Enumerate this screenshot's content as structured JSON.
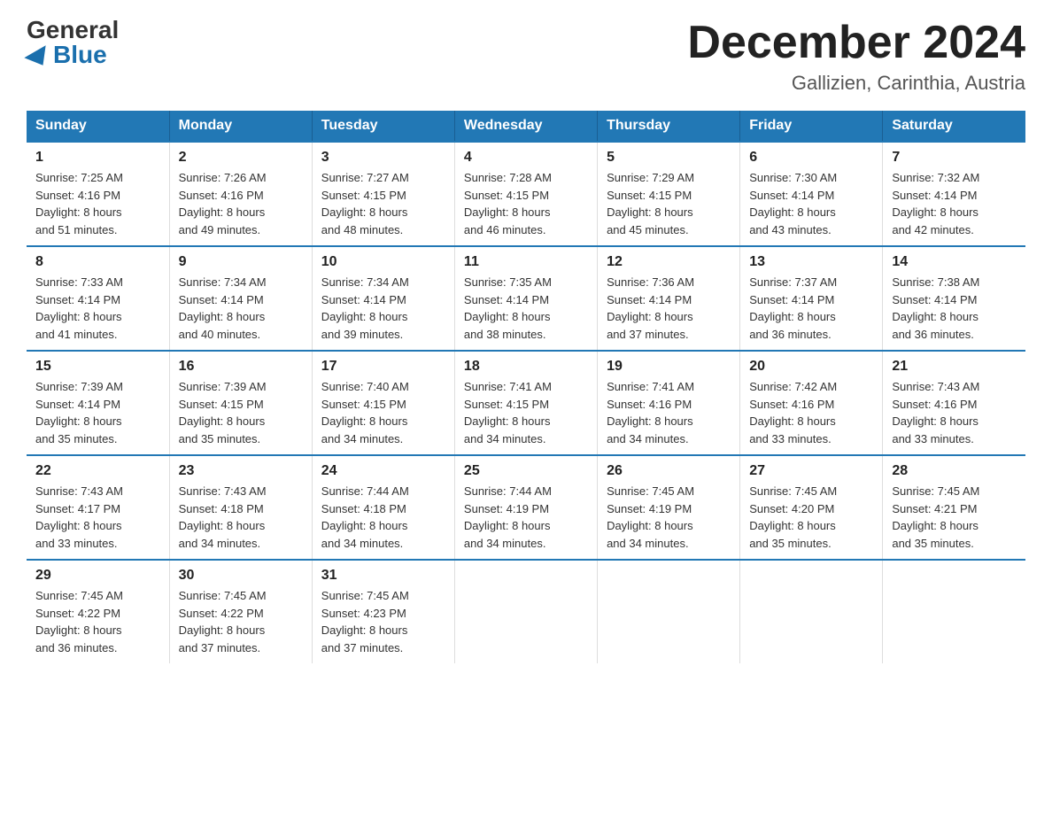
{
  "logo": {
    "general": "General",
    "blue": "Blue"
  },
  "title": "December 2024",
  "location": "Gallizien, Carinthia, Austria",
  "days_of_week": [
    "Sunday",
    "Monday",
    "Tuesday",
    "Wednesday",
    "Thursday",
    "Friday",
    "Saturday"
  ],
  "weeks": [
    [
      {
        "day": "1",
        "sunrise": "7:25 AM",
        "sunset": "4:16 PM",
        "daylight": "8 hours and 51 minutes."
      },
      {
        "day": "2",
        "sunrise": "7:26 AM",
        "sunset": "4:16 PM",
        "daylight": "8 hours and 49 minutes."
      },
      {
        "day": "3",
        "sunrise": "7:27 AM",
        "sunset": "4:15 PM",
        "daylight": "8 hours and 48 minutes."
      },
      {
        "day": "4",
        "sunrise": "7:28 AM",
        "sunset": "4:15 PM",
        "daylight": "8 hours and 46 minutes."
      },
      {
        "day": "5",
        "sunrise": "7:29 AM",
        "sunset": "4:15 PM",
        "daylight": "8 hours and 45 minutes."
      },
      {
        "day": "6",
        "sunrise": "7:30 AM",
        "sunset": "4:14 PM",
        "daylight": "8 hours and 43 minutes."
      },
      {
        "day": "7",
        "sunrise": "7:32 AM",
        "sunset": "4:14 PM",
        "daylight": "8 hours and 42 minutes."
      }
    ],
    [
      {
        "day": "8",
        "sunrise": "7:33 AM",
        "sunset": "4:14 PM",
        "daylight": "8 hours and 41 minutes."
      },
      {
        "day": "9",
        "sunrise": "7:34 AM",
        "sunset": "4:14 PM",
        "daylight": "8 hours and 40 minutes."
      },
      {
        "day": "10",
        "sunrise": "7:34 AM",
        "sunset": "4:14 PM",
        "daylight": "8 hours and 39 minutes."
      },
      {
        "day": "11",
        "sunrise": "7:35 AM",
        "sunset": "4:14 PM",
        "daylight": "8 hours and 38 minutes."
      },
      {
        "day": "12",
        "sunrise": "7:36 AM",
        "sunset": "4:14 PM",
        "daylight": "8 hours and 37 minutes."
      },
      {
        "day": "13",
        "sunrise": "7:37 AM",
        "sunset": "4:14 PM",
        "daylight": "8 hours and 36 minutes."
      },
      {
        "day": "14",
        "sunrise": "7:38 AM",
        "sunset": "4:14 PM",
        "daylight": "8 hours and 36 minutes."
      }
    ],
    [
      {
        "day": "15",
        "sunrise": "7:39 AM",
        "sunset": "4:14 PM",
        "daylight": "8 hours and 35 minutes."
      },
      {
        "day": "16",
        "sunrise": "7:39 AM",
        "sunset": "4:15 PM",
        "daylight": "8 hours and 35 minutes."
      },
      {
        "day": "17",
        "sunrise": "7:40 AM",
        "sunset": "4:15 PM",
        "daylight": "8 hours and 34 minutes."
      },
      {
        "day": "18",
        "sunrise": "7:41 AM",
        "sunset": "4:15 PM",
        "daylight": "8 hours and 34 minutes."
      },
      {
        "day": "19",
        "sunrise": "7:41 AM",
        "sunset": "4:16 PM",
        "daylight": "8 hours and 34 minutes."
      },
      {
        "day": "20",
        "sunrise": "7:42 AM",
        "sunset": "4:16 PM",
        "daylight": "8 hours and 33 minutes."
      },
      {
        "day": "21",
        "sunrise": "7:43 AM",
        "sunset": "4:16 PM",
        "daylight": "8 hours and 33 minutes."
      }
    ],
    [
      {
        "day": "22",
        "sunrise": "7:43 AM",
        "sunset": "4:17 PM",
        "daylight": "8 hours and 33 minutes."
      },
      {
        "day": "23",
        "sunrise": "7:43 AM",
        "sunset": "4:18 PM",
        "daylight": "8 hours and 34 minutes."
      },
      {
        "day": "24",
        "sunrise": "7:44 AM",
        "sunset": "4:18 PM",
        "daylight": "8 hours and 34 minutes."
      },
      {
        "day": "25",
        "sunrise": "7:44 AM",
        "sunset": "4:19 PM",
        "daylight": "8 hours and 34 minutes."
      },
      {
        "day": "26",
        "sunrise": "7:45 AM",
        "sunset": "4:19 PM",
        "daylight": "8 hours and 34 minutes."
      },
      {
        "day": "27",
        "sunrise": "7:45 AM",
        "sunset": "4:20 PM",
        "daylight": "8 hours and 35 minutes."
      },
      {
        "day": "28",
        "sunrise": "7:45 AM",
        "sunset": "4:21 PM",
        "daylight": "8 hours and 35 minutes."
      }
    ],
    [
      {
        "day": "29",
        "sunrise": "7:45 AM",
        "sunset": "4:22 PM",
        "daylight": "8 hours and 36 minutes."
      },
      {
        "day": "30",
        "sunrise": "7:45 AM",
        "sunset": "4:22 PM",
        "daylight": "8 hours and 37 minutes."
      },
      {
        "day": "31",
        "sunrise": "7:45 AM",
        "sunset": "4:23 PM",
        "daylight": "8 hours and 37 minutes."
      },
      null,
      null,
      null,
      null
    ]
  ],
  "labels": {
    "sunrise": "Sunrise:",
    "sunset": "Sunset:",
    "daylight": "Daylight:"
  }
}
